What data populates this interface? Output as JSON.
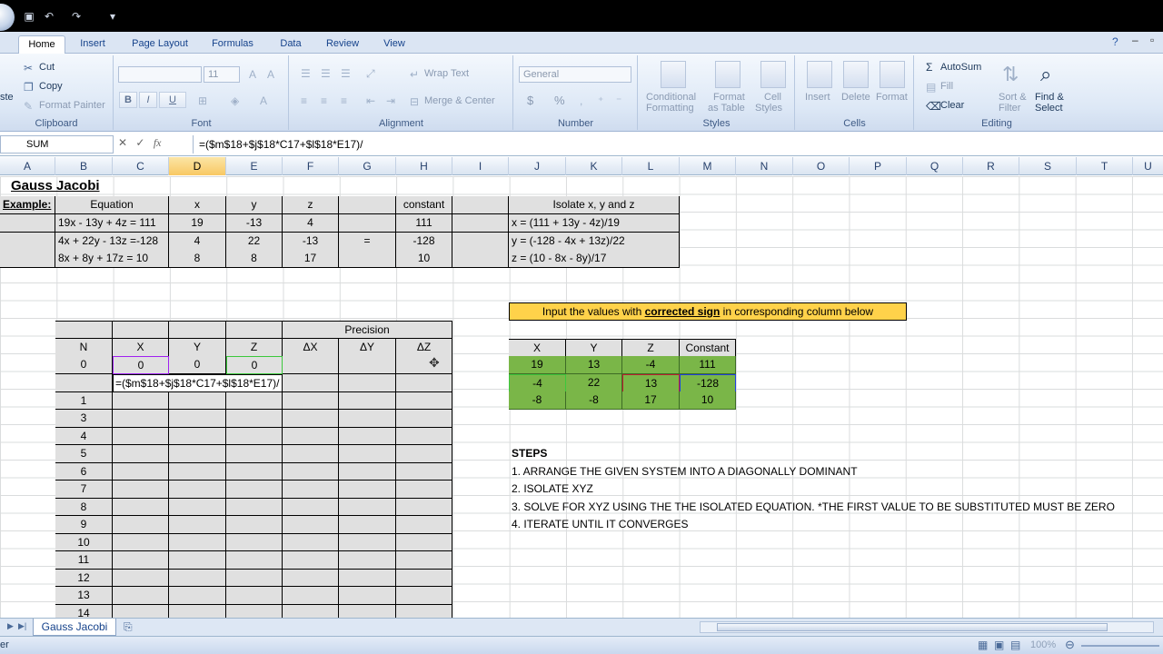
{
  "window": {
    "qat_icons": [
      "save-icon",
      "undo-icon",
      "redo-icon",
      "customize-icon"
    ]
  },
  "ribbon_tabs": [
    "Home",
    "Insert",
    "Page Layout",
    "Formulas",
    "Data",
    "Review",
    "View"
  ],
  "ribbon": {
    "clipboard": {
      "cut": "Cut",
      "copy": "Copy",
      "format_painter": "Format Painter",
      "paste_partial": "ste",
      "label": "Clipboard"
    },
    "font": {
      "size": "11",
      "bold": "B",
      "italic": "I",
      "underline": "U",
      "label": "Font"
    },
    "alignment": {
      "wrap": "Wrap Text",
      "merge": "Merge & Center",
      "label": "Alignment"
    },
    "number": {
      "format": "General",
      "currency": "$",
      "percent": "%",
      "label": "Number"
    },
    "styles": {
      "conditional": [
        "Conditional",
        "Formatting"
      ],
      "as_table": [
        "Format",
        "as Table"
      ],
      "cell_styles": [
        "Cell",
        "Styles"
      ],
      "label": "Styles"
    },
    "cells": {
      "insert": "Insert",
      "delete": "Delete",
      "format": "Format",
      "label": "Cells"
    },
    "editing": {
      "autosum": "AutoSum",
      "fill": "Fill",
      "clear": "Clear",
      "sort": [
        "Sort &",
        "Filter"
      ],
      "find": [
        "Find &",
        "Select"
      ],
      "label": "Editing"
    }
  },
  "formula_bar": {
    "name_box": "SUM",
    "fx": "fx",
    "formula": "=($m$18+$j$18*C17+$l$18*E17)/"
  },
  "columns": [
    "A",
    "B",
    "C",
    "D",
    "E",
    "F",
    "G",
    "H",
    "I",
    "J",
    "K",
    "L",
    "M",
    "N",
    "O",
    "P",
    "Q",
    "R",
    "S",
    "T",
    "U"
  ],
  "sheet": {
    "title": "Gauss Jacobi",
    "example_label": "Example:",
    "eq_headers": [
      "Equation",
      "x",
      "y",
      "z",
      "",
      "constant",
      ""
    ],
    "equations": [
      {
        "eq": "19x - 13y + 4z = 111",
        "x": "19",
        "y": "-13",
        "z": "4",
        "eq_sign": "",
        "c": "111"
      },
      {
        "eq": "4x + 22y - 13z =-128",
        "x": "4",
        "y": "22",
        "z": "-13",
        "eq_sign": "=",
        "c": "-128"
      },
      {
        "eq": "8x + 8y + 17z = 10",
        "x": "8",
        "y": "8",
        "z": "17",
        "eq_sign": "",
        "c": "10"
      }
    ],
    "isolate_header": "Isolate x, y and z",
    "isolate": [
      "x = (111 + 13y - 4z)/19",
      "y = (-128 - 4x + 13z)/22",
      "z = (10 - 8x - 8y)/17"
    ],
    "instruction": {
      "pre": "Input the values with ",
      "emph": "corrected sign",
      "post": " in corresponding column below"
    },
    "precision_label": "Precision",
    "iter_headers": [
      "N",
      "X",
      "Y",
      "Z",
      "ΔX",
      "ΔY",
      "ΔZ"
    ],
    "iter_row0": [
      "0",
      "0",
      "0",
      "0"
    ],
    "editing_formula": "=($m$18+$j$18*C17+$l$18*E17)/",
    "iter_numbers": [
      "1",
      "3",
      "4",
      "5",
      "6",
      "7",
      "8",
      "9",
      "10",
      "11",
      "12",
      "13",
      "14"
    ],
    "coef_headers": [
      "X",
      "Y",
      "Z",
      "Constant"
    ],
    "coefs": [
      [
        "19",
        "13",
        "-4",
        "111"
      ],
      [
        "-4",
        "22",
        "13",
        "-128"
      ],
      [
        "-8",
        "-8",
        "17",
        "10"
      ]
    ],
    "steps_title": "STEPS",
    "steps": [
      "1. ARRANGE THE GIVEN SYSTEM INTO A DIAGONALLY DOMINANT",
      "2. ISOLATE XYZ",
      "3. SOLVE FOR XYZ USING THE THE ISOLATED EQUATION. *THE FIRST VALUE TO BE SUBSTITUTED MUST BE ZERO",
      "4. ITERATE UNTIL IT CONVERGES"
    ]
  },
  "sheet_tab": "Gauss Jacobi",
  "status": {
    "mode_partial": "er",
    "zoom": "100%"
  }
}
